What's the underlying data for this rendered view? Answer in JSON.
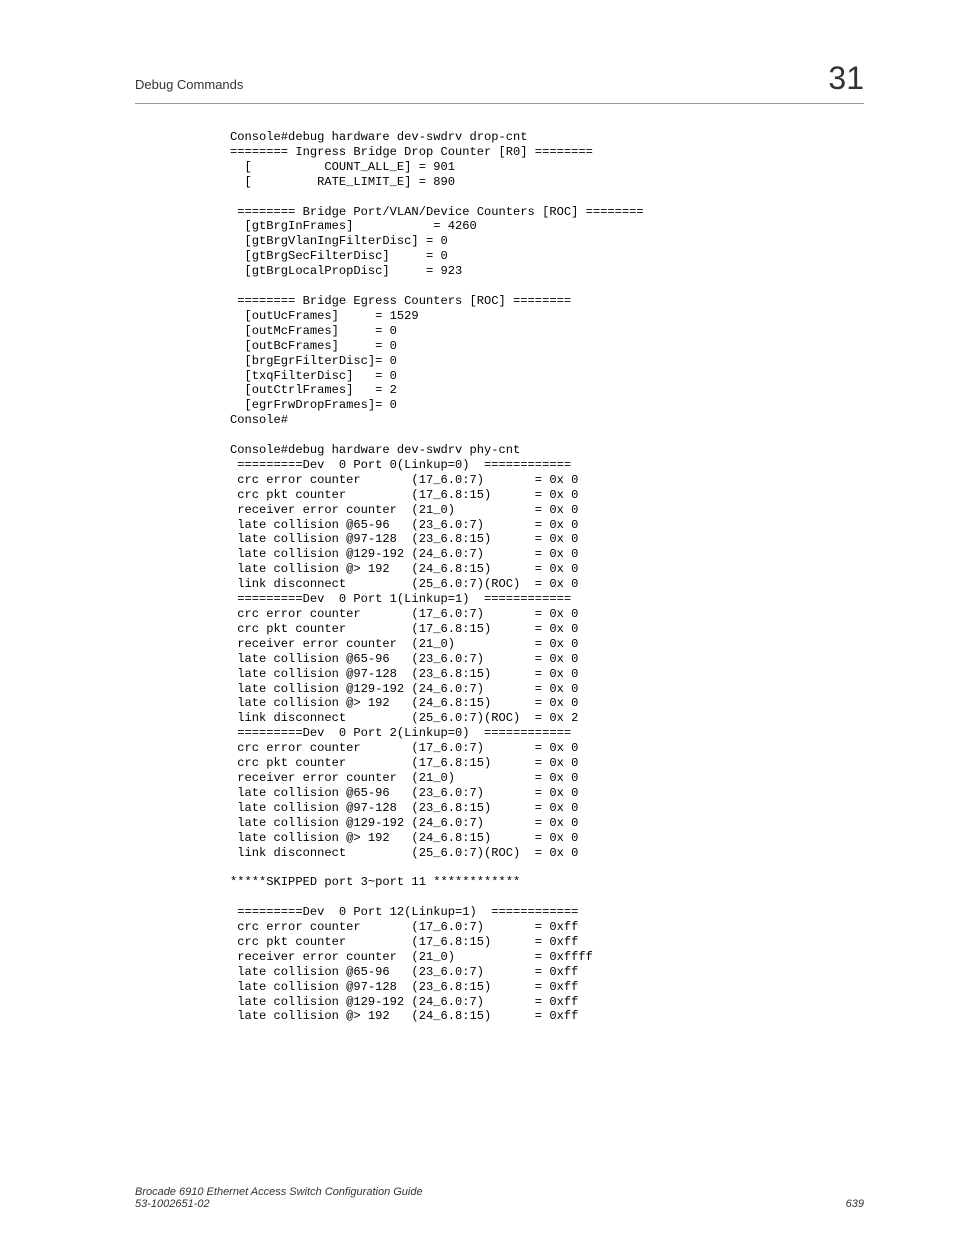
{
  "header": {
    "section": "Debug Commands",
    "chapter": "31"
  },
  "console": "Console#debug hardware dev-swdrv drop-cnt\n======== Ingress Bridge Drop Counter [R0] ========\n  [          COUNT_ALL_E] = 901\n  [         RATE_LIMIT_E] = 890\n\n ======== Bridge Port/VLAN/Device Counters [ROC] ========\n  [gtBrgInFrames]           = 4260\n  [gtBrgVlanIngFilterDisc] = 0\n  [gtBrgSecFilterDisc]     = 0\n  [gtBrgLocalPropDisc]     = 923\n\n ======== Bridge Egress Counters [ROC] ========\n  [outUcFrames]     = 1529\n  [outMcFrames]     = 0\n  [outBcFrames]     = 0\n  [brgEgrFilterDisc]= 0\n  [txqFilterDisc]   = 0\n  [outCtrlFrames]   = 2\n  [egrFrwDropFrames]= 0\nConsole#\n\nConsole#debug hardware dev-swdrv phy-cnt\n =========Dev  0 Port 0(Linkup=0)  ============\n crc error counter       (17_6.0:7)       = 0x 0\n crc pkt counter         (17_6.8:15)      = 0x 0\n receiver error counter  (21_0)           = 0x 0\n late collision @65-96   (23_6.0:7)       = 0x 0\n late collision @97-128  (23_6.8:15)      = 0x 0\n late collision @129-192 (24_6.0:7)       = 0x 0\n late collision @> 192   (24_6.8:15)      = 0x 0\n link disconnect         (25_6.0:7)(ROC)  = 0x 0\n =========Dev  0 Port 1(Linkup=1)  ============\n crc error counter       (17_6.0:7)       = 0x 0\n crc pkt counter         (17_6.8:15)      = 0x 0\n receiver error counter  (21_0)           = 0x 0\n late collision @65-96   (23_6.0:7)       = 0x 0\n late collision @97-128  (23_6.8:15)      = 0x 0\n late collision @129-192 (24_6.0:7)       = 0x 0\n late collision @> 192   (24_6.8:15)      = 0x 0\n link disconnect         (25_6.0:7)(ROC)  = 0x 2\n =========Dev  0 Port 2(Linkup=0)  ============\n crc error counter       (17_6.0:7)       = 0x 0\n crc pkt counter         (17_6.8:15)      = 0x 0\n receiver error counter  (21_0)           = 0x 0\n late collision @65-96   (23_6.0:7)       = 0x 0\n late collision @97-128  (23_6.8:15)      = 0x 0\n late collision @129-192 (24_6.0:7)       = 0x 0\n late collision @> 192   (24_6.8:15)      = 0x 0\n link disconnect         (25_6.0:7)(ROC)  = 0x 0\n\n*****SKIPPED port 3~port 11 ************\n\n =========Dev  0 Port 12(Linkup=1)  ============\n crc error counter       (17_6.0:7)       = 0xff\n crc pkt counter         (17_6.8:15)      = 0xff\n receiver error counter  (21_0)           = 0xffff\n late collision @65-96   (23_6.0:7)       = 0xff\n late collision @97-128  (23_6.8:15)      = 0xff\n late collision @129-192 (24_6.0:7)       = 0xff\n late collision @> 192   (24_6.8:15)      = 0xff",
  "footer": {
    "title": "Brocade 6910 Ethernet Access Switch Configuration Guide",
    "docnum": "53-1002651-02",
    "page": "639"
  }
}
